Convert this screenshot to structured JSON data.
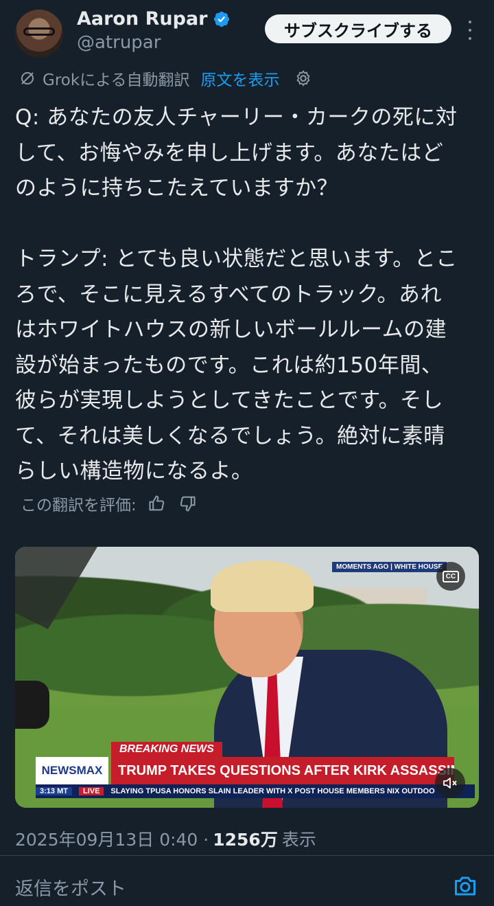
{
  "user": {
    "name": "Aaron Rupar",
    "handle": "@atrupar",
    "verified": true
  },
  "subscribe_label": "サブスクライブする",
  "translation": {
    "label": "Grokによる自動翻訳",
    "show_original": "原文を表示"
  },
  "tweet_text": "Q: あなたの友人チャーリー・カークの死に対\nして、お悔やみを申し上げます。あなたはど\nのように持ちこたえていますか？\n\nトランプ: とても良い状態だと思います。とこ\nろで、そこに見えるすべてのトラック。あれ\nはホワイトハウスの新しいボールルームの建\n設が始まったものです。これは約150年間、\n彼らが実現しようとしてきたことです。そし\nて、それは美しくなるでしょう。絶対に素晴\nらしい構造物になるよ。",
  "rate_label": "この翻訳を評価:",
  "video": {
    "moments_tag": "MOMENTS AGO | WHITE HOUSE",
    "cc": "CC",
    "breaking": "BREAKING NEWS",
    "network": "NEWSMAX",
    "headline": "TRUMP TAKES QUESTIONS AFTER KIRK ASSASSINATION",
    "ticker_time": "3:13 MT",
    "ticker_live": "LIVE",
    "ticker_items": "SLAYING    TPUSA HONORS SLAIN LEADER WITH X POST    HOUSE MEMBERS NIX OUTDOO"
  },
  "meta": {
    "date": "2025年09月13日 0:40 ·",
    "views": "1256万",
    "views_label": "表示"
  },
  "reply_placeholder": "返信をポスト",
  "colors": {
    "background": "#15202b",
    "accent": "#1d9bf0",
    "muted": "#8b98a5"
  }
}
